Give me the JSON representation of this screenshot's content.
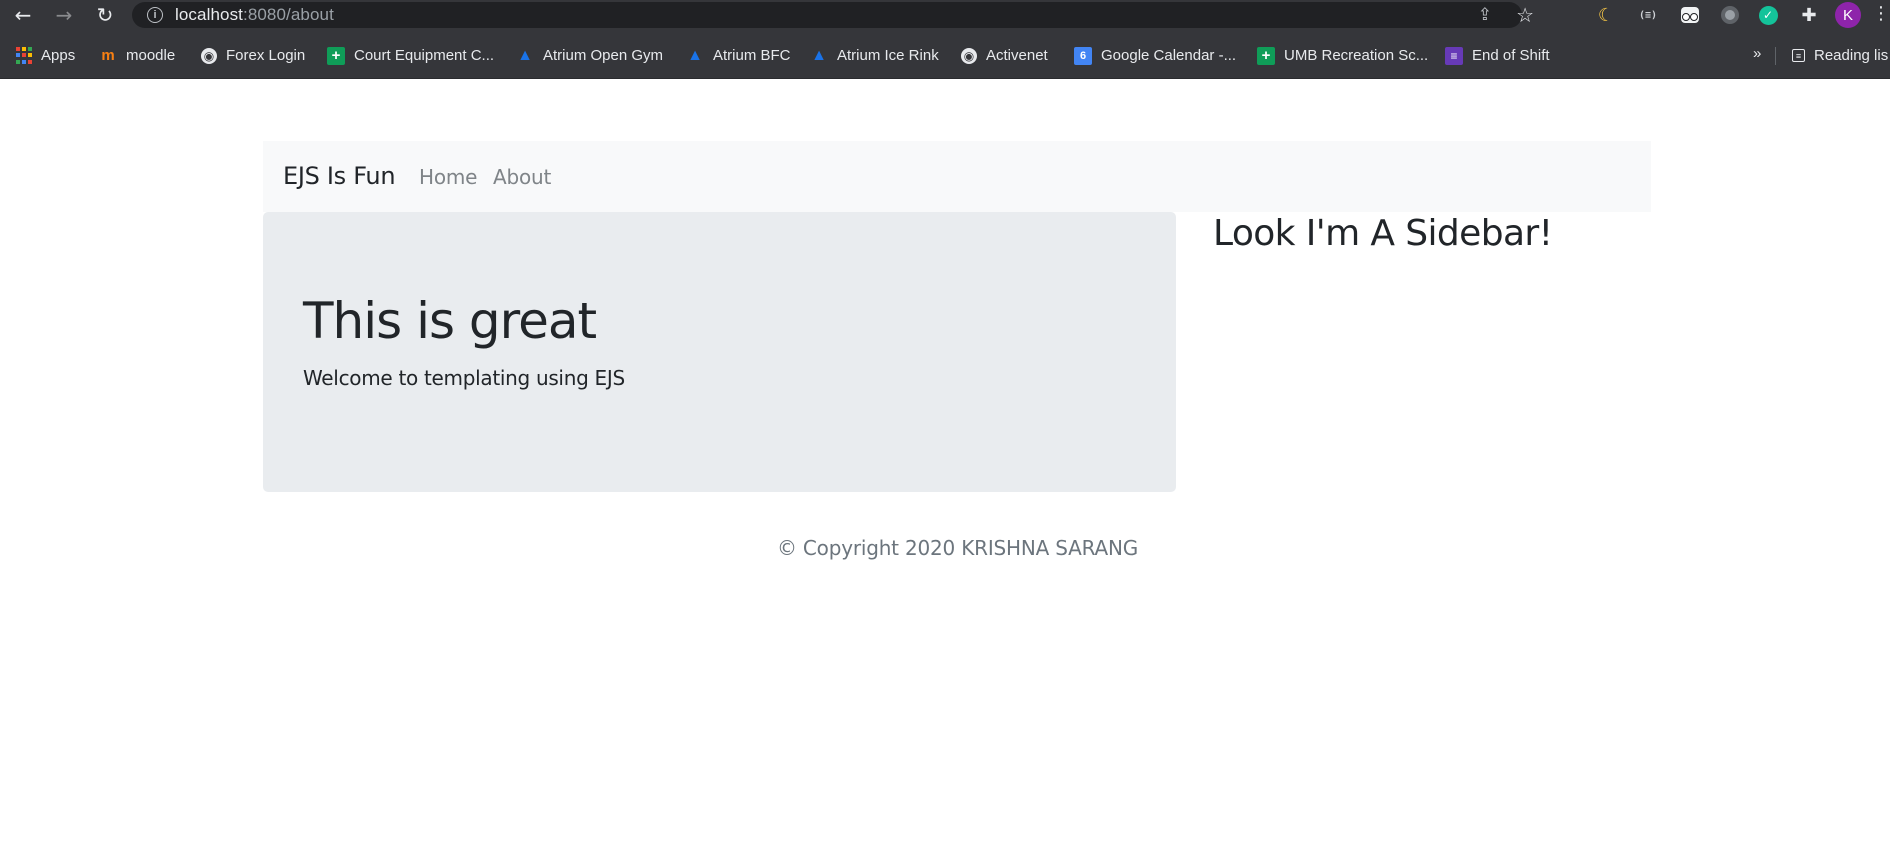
{
  "browser": {
    "url_host": "localhost",
    "url_path": ":8080/about",
    "icons": {
      "back": "←",
      "forward": "→",
      "reload": "↻",
      "info": "i",
      "share": "⇪",
      "star": "☆",
      "moon": "☾",
      "bracket": "(≡)",
      "check": "✓",
      "puzzle": "✚",
      "more": "⋮",
      "overflow": "»"
    },
    "avatar_initial": "K",
    "bookmarks": [
      {
        "label": "Apps",
        "icon": "A"
      },
      {
        "label": "moodle",
        "icon": "m"
      },
      {
        "label": "Forex Login",
        "icon": "◉"
      },
      {
        "label": "Court Equipment C...",
        "icon": "+"
      },
      {
        "label": "Atrium Open Gym",
        "icon": "▲"
      },
      {
        "label": "Atrium BFC",
        "icon": "▲"
      },
      {
        "label": "Atrium Ice Rink",
        "icon": "▲"
      },
      {
        "label": "Activenet",
        "icon": "◉"
      },
      {
        "label": "Google Calendar -...",
        "icon": "6"
      },
      {
        "label": "UMB Recreation Sc...",
        "icon": "+"
      },
      {
        "label": "End of Shift",
        "icon": "≡"
      }
    ],
    "reading_list": {
      "label": "Reading lis",
      "icon": "≡"
    }
  },
  "site": {
    "brand": "EJS Is Fun",
    "nav": [
      "Home",
      "About"
    ],
    "jumbotron": {
      "title": "This is great",
      "lead": "Welcome to templating using EJS"
    },
    "sidebar_title": "Look I'm A Sidebar!",
    "footer": "© Copyright 2020 KRISHNA SARANG"
  }
}
